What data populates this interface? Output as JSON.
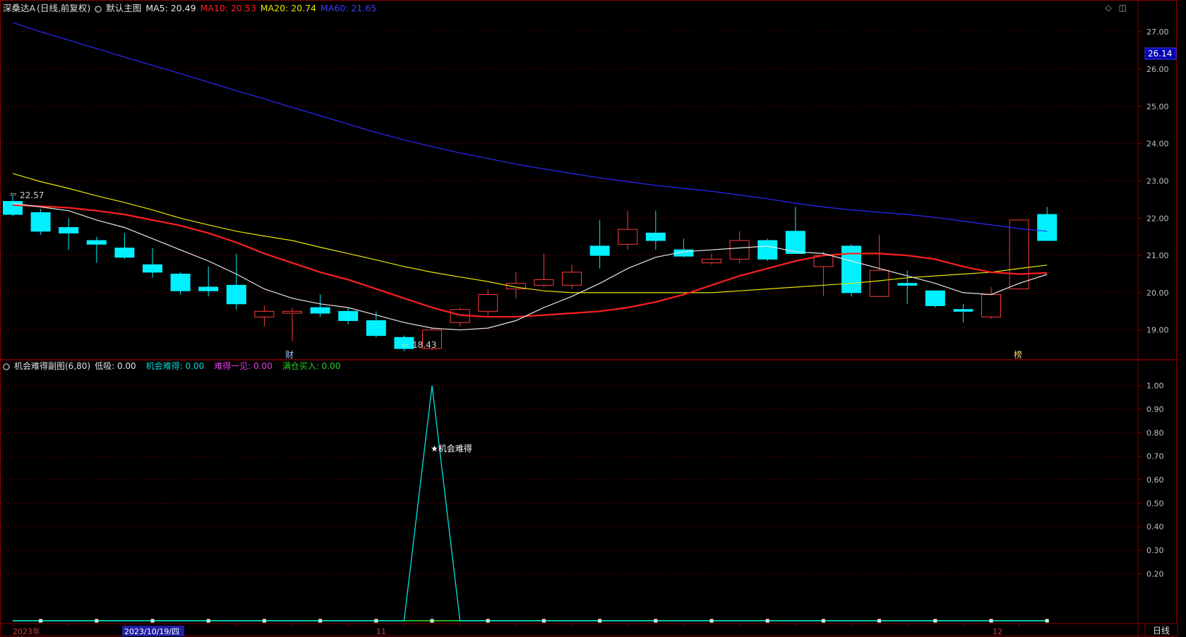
{
  "main_header": {
    "stock_name": "深桑达A",
    "period_label": "(日线,前复权)",
    "template_label": "默认主图",
    "ma5": "MA5: 20.49",
    "ma10": "MA10: 20.53",
    "ma20": "MA20: 20.74",
    "ma60": "MA60: 21.65"
  },
  "sub_header": {
    "indicator_name": "机会难得副图(6,80)",
    "low_buy": "低吸: 0.00",
    "chance": "机会难得: 0.00",
    "rare": "难得一见: 0.00",
    "full_buy": "满仓买入: 0.00"
  },
  "colors": {
    "up": "#ff3b3b",
    "down": "#00f0ff",
    "ma5": "#e8e8e8",
    "ma10": "#ff2020",
    "ma20": "#e8e800",
    "ma60": "#2a2aff",
    "grid": "#8b0000",
    "axis_text": "#c0c0c0",
    "low_buy": "#cccccc",
    "chance": "#00d8d8",
    "rare": "#e040e0",
    "full_buy": "#20d020"
  },
  "price_axis": {
    "ticks": [
      "27.00",
      "26.00",
      "25.00",
      "24.00",
      "23.00",
      "22.00",
      "21.00",
      "20.00",
      "19.00"
    ],
    "current_price": "26.14"
  },
  "sub_axis": {
    "ticks": [
      "1.00",
      "0.90",
      "0.80",
      "0.70",
      "0.60",
      "0.50",
      "0.40",
      "0.30",
      "0.20"
    ]
  },
  "annotations": {
    "high_label": "22.57",
    "low_label": "18.43",
    "cai_marker": "财",
    "bang_marker": "榜",
    "signal_label": "★机会难得"
  },
  "time_axis": {
    "labels": [
      "2023年",
      "11",
      "12"
    ],
    "cursor_date": "2023/10/19/四",
    "period_button": "日线"
  },
  "chart_data": [
    {
      "type": "candlestick",
      "title": "深桑达A (日线,前复权)",
      "ylim": [
        18.2,
        27.4
      ],
      "candles": [
        {
          "o": 22.45,
          "h": 22.6,
          "l": 22.05,
          "c": 22.1
        },
        {
          "o": 22.15,
          "h": 22.25,
          "l": 21.55,
          "c": 21.65
        },
        {
          "o": 21.75,
          "h": 22.0,
          "l": 21.15,
          "c": 21.6
        },
        {
          "o": 21.4,
          "h": 21.5,
          "l": 20.8,
          "c": 21.3
        },
        {
          "o": 21.2,
          "h": 21.6,
          "l": 20.9,
          "c": 20.95
        },
        {
          "o": 20.75,
          "h": 21.2,
          "l": 20.4,
          "c": 20.55
        },
        {
          "o": 20.5,
          "h": 20.55,
          "l": 19.95,
          "c": 20.05
        },
        {
          "o": 20.15,
          "h": 20.7,
          "l": 19.9,
          "c": 20.05
        },
        {
          "o": 20.2,
          "h": 21.05,
          "l": 19.55,
          "c": 19.7
        },
        {
          "o": 19.35,
          "h": 19.65,
          "l": 19.1,
          "c": 19.5
        },
        {
          "o": 19.45,
          "h": 19.6,
          "l": 18.7,
          "c": 19.5
        },
        {
          "o": 19.6,
          "h": 19.95,
          "l": 19.35,
          "c": 19.45
        },
        {
          "o": 19.5,
          "h": 19.6,
          "l": 19.15,
          "c": 19.25
        },
        {
          "o": 19.25,
          "h": 19.5,
          "l": 18.8,
          "c": 18.85
        },
        {
          "o": 18.8,
          "h": 18.85,
          "l": 18.43,
          "c": 18.5
        },
        {
          "o": 18.5,
          "h": 19.05,
          "l": 18.45,
          "c": 19.0
        },
        {
          "o": 19.2,
          "h": 19.6,
          "l": 19.1,
          "c": 19.55
        },
        {
          "o": 19.5,
          "h": 20.1,
          "l": 19.35,
          "c": 19.95
        },
        {
          "o": 20.1,
          "h": 20.55,
          "l": 19.85,
          "c": 20.25
        },
        {
          "o": 20.2,
          "h": 21.05,
          "l": 20.15,
          "c": 20.35
        },
        {
          "o": 20.2,
          "h": 20.75,
          "l": 20.1,
          "c": 20.55
        },
        {
          "o": 21.25,
          "h": 21.95,
          "l": 20.65,
          "c": 21.0
        },
        {
          "o": 21.3,
          "h": 22.2,
          "l": 21.15,
          "c": 21.7
        },
        {
          "o": 21.6,
          "h": 22.2,
          "l": 21.15,
          "c": 21.4
        },
        {
          "o": 21.15,
          "h": 21.45,
          "l": 20.95,
          "c": 20.98
        },
        {
          "o": 20.8,
          "h": 21.05,
          "l": 20.75,
          "c": 20.9
        },
        {
          "o": 20.9,
          "h": 21.65,
          "l": 20.8,
          "c": 21.4
        },
        {
          "o": 21.4,
          "h": 21.45,
          "l": 20.85,
          "c": 20.9
        },
        {
          "o": 21.65,
          "h": 22.3,
          "l": 21.05,
          "c": 21.05
        },
        {
          "o": 20.7,
          "h": 21.1,
          "l": 19.9,
          "c": 21.0
        },
        {
          "o": 21.25,
          "h": 21.3,
          "l": 19.9,
          "c": 20.0
        },
        {
          "o": 19.9,
          "h": 21.55,
          "l": 19.9,
          "c": 20.6
        },
        {
          "o": 20.25,
          "h": 20.6,
          "l": 19.7,
          "c": 20.2
        },
        {
          "o": 20.05,
          "h": 20.05,
          "l": 19.6,
          "c": 19.65
        },
        {
          "o": 19.55,
          "h": 19.7,
          "l": 19.2,
          "c": 19.5
        },
        {
          "o": 19.35,
          "h": 20.15,
          "l": 19.3,
          "c": 19.95
        },
        {
          "o": 20.1,
          "h": 21.95,
          "l": 20.1,
          "c": 21.95
        },
        {
          "o": 22.1,
          "h": 22.3,
          "l": 21.4,
          "c": 21.4
        }
      ],
      "ma5": [
        22.4,
        22.3,
        22.2,
        21.95,
        21.75,
        21.45,
        21.15,
        20.85,
        20.5,
        20.1,
        19.85,
        19.7,
        19.6,
        19.4,
        19.2,
        19.05,
        19.0,
        19.05,
        19.25,
        19.6,
        19.9,
        20.25,
        20.65,
        20.95,
        21.1,
        21.15,
        21.2,
        21.25,
        21.1,
        21.05,
        20.85,
        20.65,
        20.45,
        20.25,
        20.0,
        19.95,
        20.25,
        20.49
      ],
      "ma10": [
        22.35,
        22.32,
        22.28,
        22.2,
        22.1,
        21.95,
        21.8,
        21.6,
        21.35,
        21.05,
        20.8,
        20.55,
        20.35,
        20.1,
        19.85,
        19.6,
        19.4,
        19.35,
        19.35,
        19.4,
        19.45,
        19.5,
        19.6,
        19.75,
        19.95,
        20.2,
        20.45,
        20.65,
        20.85,
        21.0,
        21.05,
        21.05,
        21.0,
        20.9,
        20.7,
        20.55,
        20.5,
        20.53
      ],
      "ma20": [
        23.2,
        22.98,
        22.8,
        22.6,
        22.42,
        22.22,
        22.0,
        21.82,
        21.65,
        21.52,
        21.4,
        21.22,
        21.05,
        20.88,
        20.7,
        20.55,
        20.42,
        20.3,
        20.15,
        20.05,
        20.0,
        20.0,
        20.0,
        20.0,
        20.0,
        20.0,
        20.05,
        20.1,
        20.15,
        20.2,
        20.25,
        20.32,
        20.4,
        20.45,
        20.5,
        20.55,
        20.65,
        20.74
      ],
      "ma60": [
        27.25,
        27.0,
        26.78,
        26.55,
        26.32,
        26.1,
        25.88,
        25.65,
        25.42,
        25.2,
        24.97,
        24.75,
        24.52,
        24.3,
        24.1,
        23.92,
        23.75,
        23.6,
        23.45,
        23.32,
        23.2,
        23.08,
        22.98,
        22.88,
        22.8,
        22.72,
        22.62,
        22.52,
        22.4,
        22.3,
        22.22,
        22.16,
        22.1,
        22.02,
        21.92,
        21.82,
        21.72,
        21.65
      ]
    },
    {
      "type": "line",
      "title": "机会难得副图(6,80)",
      "ylim": [
        0,
        1.05
      ],
      "series": [
        {
          "name": "机会难得",
          "values": [
            0,
            0,
            0,
            0,
            0,
            0,
            0,
            0,
            0,
            0,
            0,
            0,
            0,
            0,
            0,
            1,
            0,
            0,
            0,
            0,
            0,
            0,
            0,
            0,
            0,
            0,
            0,
            0,
            0,
            0,
            0,
            0,
            0,
            0,
            0,
            0,
            0,
            0
          ]
        },
        {
          "name": "满仓买入",
          "values": [
            0,
            0,
            0,
            0,
            0,
            0,
            0,
            0,
            0,
            0,
            0,
            0,
            0,
            0,
            0,
            0,
            0,
            0,
            0,
            0,
            0,
            0,
            0,
            0,
            0,
            0,
            0,
            0,
            0,
            0,
            0,
            0,
            0,
            0,
            0,
            0,
            0,
            0
          ]
        }
      ]
    }
  ]
}
